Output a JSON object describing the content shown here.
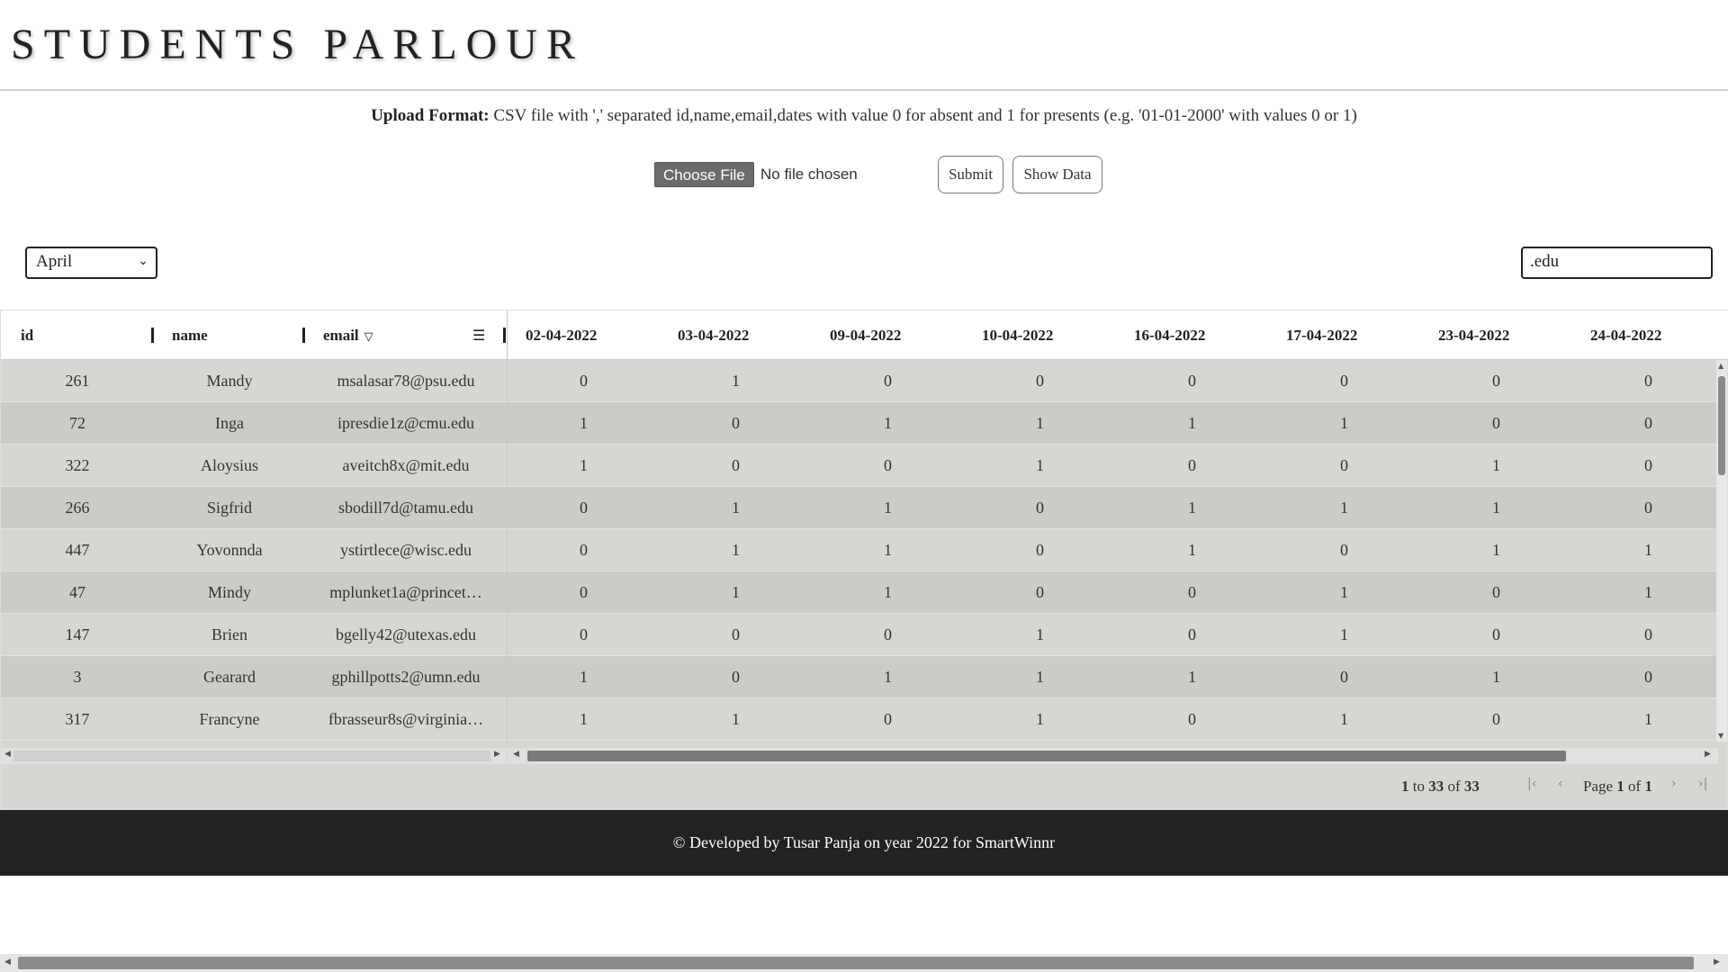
{
  "app": {
    "title": "STUDENTS PARLOUR"
  },
  "upload": {
    "format_label": "Upload Format:",
    "format_text": " CSV file with ',' separated id,name,email,dates with value 0 for absent and 1 for presents (e.g. '01-01-2000' with values 0 or 1)",
    "choose_file_label": "Choose File",
    "no_file_text": "No file chosen",
    "submit_label": "Submit",
    "show_data_label": "Show Data"
  },
  "filters": {
    "month_selected": "April",
    "search_value": ".edu"
  },
  "grid": {
    "columns": {
      "id": "id",
      "name": "name",
      "email": "email",
      "dates": [
        "02-04-2022",
        "03-04-2022",
        "09-04-2022",
        "10-04-2022",
        "16-04-2022",
        "17-04-2022",
        "23-04-2022",
        "24-04-2022"
      ]
    },
    "rows": [
      {
        "id": "261",
        "name": "Mandy",
        "email": "msalasar78@psu.edu",
        "values": [
          "0",
          "1",
          "0",
          "0",
          "0",
          "0",
          "0",
          "0"
        ]
      },
      {
        "id": "72",
        "name": "Inga",
        "email": "ipresdie1z@cmu.edu",
        "values": [
          "1",
          "0",
          "1",
          "1",
          "1",
          "1",
          "0",
          "0"
        ]
      },
      {
        "id": "322",
        "name": "Aloysius",
        "email": "aveitch8x@mit.edu",
        "values": [
          "1",
          "0",
          "0",
          "1",
          "0",
          "0",
          "1",
          "0"
        ]
      },
      {
        "id": "266",
        "name": "Sigfrid",
        "email": "sbodill7d@tamu.edu",
        "values": [
          "0",
          "1",
          "1",
          "0",
          "1",
          "1",
          "1",
          "0"
        ]
      },
      {
        "id": "447",
        "name": "Yovonnda",
        "email": "ystirtlece@wisc.edu",
        "values": [
          "0",
          "1",
          "1",
          "0",
          "1",
          "0",
          "1",
          "1"
        ]
      },
      {
        "id": "47",
        "name": "Mindy",
        "email": "mplunket1a@princet…",
        "values": [
          "0",
          "1",
          "1",
          "0",
          "0",
          "1",
          "0",
          "1"
        ]
      },
      {
        "id": "147",
        "name": "Brien",
        "email": "bgelly42@utexas.edu",
        "values": [
          "0",
          "0",
          "0",
          "1",
          "0",
          "1",
          "0",
          "0"
        ]
      },
      {
        "id": "3",
        "name": "Gearard",
        "email": "gphillpotts2@umn.edu",
        "values": [
          "1",
          "0",
          "1",
          "1",
          "1",
          "0",
          "1",
          "0"
        ]
      },
      {
        "id": "317",
        "name": "Francyne",
        "email": "fbrasseur8s@virginia…",
        "values": [
          "1",
          "1",
          "0",
          "1",
          "0",
          "1",
          "0",
          "1"
        ]
      }
    ],
    "pagination": {
      "from": "1",
      "to_word": "to",
      "to": "33",
      "of_word": "of",
      "total": "33",
      "page_word": "Page",
      "page": "1",
      "page_of_word": "of",
      "page_total": "1"
    }
  },
  "footer": {
    "text": "© Developed by Tusar Panja on year 2022 for SmartWinnr"
  }
}
